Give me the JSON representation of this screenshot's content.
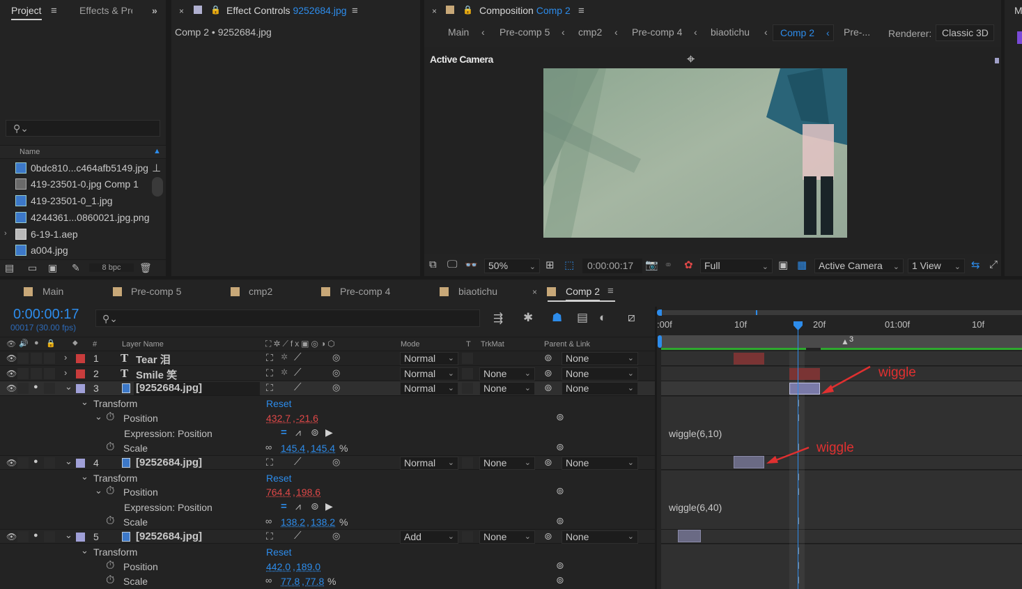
{
  "project_panel": {
    "tab_label": "Project",
    "effects_tab_label": "Effects & Pre",
    "search_placeholder": "",
    "column_name": "Name",
    "files": [
      {
        "name": "0bdc810...c464afb5149.jpg",
        "type": "image"
      },
      {
        "name": "419-23501-0.jpg Comp 1",
        "type": "comp"
      },
      {
        "name": "419-23501-0_1.jpg",
        "type": "image"
      },
      {
        "name": "4244361...0860021.jpg.png",
        "type": "image"
      },
      {
        "name": "6-19-1.aep",
        "type": "folder"
      },
      {
        "name": "a004.jpg",
        "type": "image"
      }
    ],
    "bpc_label": "8 bpc"
  },
  "effect_controls": {
    "tab_prefix": "Effect Controls",
    "tab_file": "9252684.jpg",
    "subtitle": "Comp 2 • 9252684.jpg"
  },
  "composition": {
    "tab_prefix": "Composition",
    "tab_comp": "Comp 2",
    "breadcrumbs": [
      "Main",
      "Pre-comp 5",
      "cmp2",
      "Pre-comp 4",
      "biaotichu",
      "Comp 2",
      "Pre-..."
    ],
    "renderer_label": "Renderer:",
    "renderer_value": "Classic 3D",
    "camera_label": "Active Camera",
    "zoom": "50%",
    "timecode": "0:00:00:17",
    "resolution": "Full",
    "view_camera": "Active Camera",
    "view_count": "1 View"
  },
  "timeline": {
    "tabs": [
      "Main",
      "Pre-comp 5",
      "cmp2",
      "Pre-comp 4",
      "biaotichu",
      "Comp 2"
    ],
    "current_time": "0:00:00:17",
    "frame_info": "00017 (30.00 fps)",
    "headers": {
      "layer_name": "Layer Name",
      "mode": "Mode",
      "t": "T",
      "trkmat": "TrkMat",
      "parent": "Parent & Link",
      "num": "#"
    },
    "ruler_labels": [
      ":00f",
      "10f",
      "20f",
      "01:00f",
      "10f"
    ],
    "marker_label": "3",
    "layers": [
      {
        "num": "1",
        "name": "Tear 泪",
        "kind": "T",
        "mode": "Normal",
        "trkmat": "",
        "parent": "None",
        "label_color": "#c83c3c"
      },
      {
        "num": "2",
        "name": "Smile 笑",
        "kind": "T",
        "mode": "Normal",
        "trkmat": "None",
        "parent": "None",
        "label_color": "#c83c3c"
      },
      {
        "num": "3",
        "name": "[9252684.jpg]",
        "kind": "img",
        "mode": "Normal",
        "trkmat": "None",
        "parent": "None",
        "label_color": "#a0a0d8"
      },
      {
        "num": "4",
        "name": "[9252684.jpg]",
        "kind": "img",
        "mode": "Normal",
        "trkmat": "None",
        "parent": "None",
        "label_color": "#a0a0d8"
      },
      {
        "num": "5",
        "name": "[9252684.jpg]",
        "kind": "img",
        "mode": "Add",
        "trkmat": "None",
        "parent": "None",
        "label_color": "#a0a0d8"
      }
    ],
    "props": {
      "transform": "Transform",
      "reset": "Reset",
      "position": "Position",
      "expression_position": "Expression: Position",
      "scale": "Scale",
      "l3_pos_x": "432.7",
      "l3_pos_y": "-21.6",
      "l3_scale_x": "145.4",
      "l3_scale_y": "145.4",
      "l4_pos_x": "764.4",
      "l4_pos_y": "198.6",
      "l4_scale_x": "138.2",
      "l4_scale_y": "138.2",
      "l5_pos_x": "442.0",
      "l5_pos_y": "189.0",
      "l5_scale_x": "77.8",
      "l5_scale_y": "77.8",
      "pct": "%"
    },
    "expressions": {
      "l3": "wiggle(6,10)",
      "l4": "wiggle(6,40)"
    },
    "annotations": [
      "wiggle",
      "wiggle"
    ]
  },
  "colors": {
    "accent": "#2d8ceb",
    "value_red": "#e04848",
    "annotation": "#e03030",
    "panel": "#232323"
  }
}
